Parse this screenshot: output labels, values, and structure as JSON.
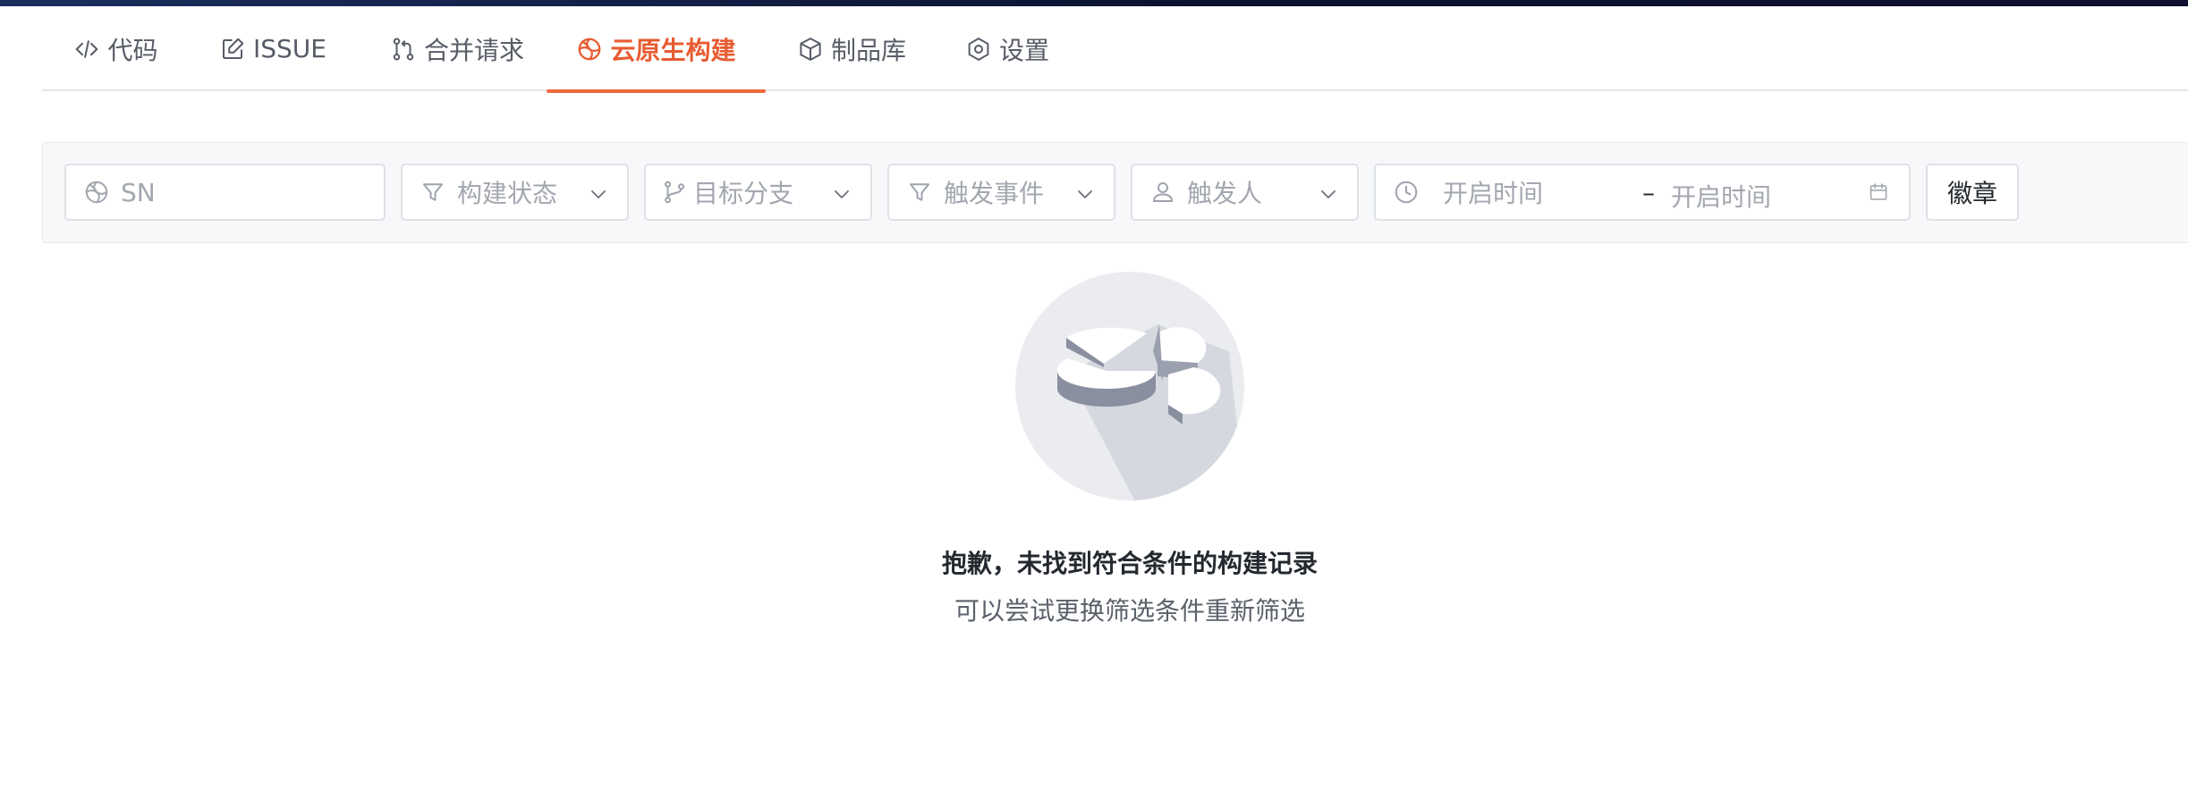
{
  "tabs": [
    {
      "label": "代码",
      "icon": "code-icon"
    },
    {
      "label": "ISSUE",
      "icon": "issue-icon"
    },
    {
      "label": "合并请求",
      "icon": "merge-request-icon"
    },
    {
      "label": "云原生构建",
      "icon": "build-icon",
      "active": true
    },
    {
      "label": "制品库",
      "icon": "package-icon"
    },
    {
      "label": "设置",
      "icon": "settings-icon"
    }
  ],
  "filters": {
    "sn": {
      "placeholder": "SN",
      "value": ""
    },
    "status": {
      "placeholder": "构建状态"
    },
    "branch": {
      "placeholder": "目标分支"
    },
    "event": {
      "placeholder": "触发事件"
    },
    "trigger_user": {
      "placeholder": "触发人"
    },
    "time_range": {
      "start_placeholder": "开启时间",
      "separator": "–",
      "end_placeholder": "开启时间"
    },
    "badge_button": "徽章"
  },
  "empty_state": {
    "title": "抱歉，未找到符合条件的构建记录",
    "subtitle": "可以尝试更换筛选条件重新筛选"
  },
  "colors": {
    "accent": "#e85c32",
    "text": "#24292f",
    "placeholder": "#a3a7af",
    "border": "#dfe1e6"
  }
}
